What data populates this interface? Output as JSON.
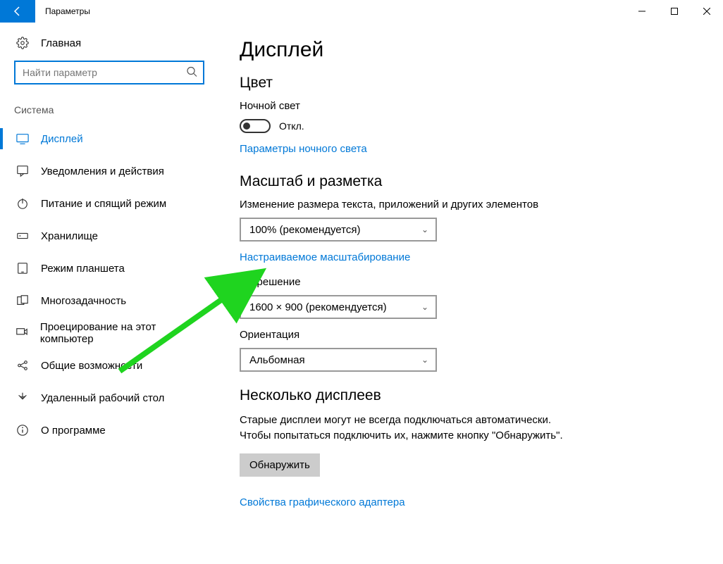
{
  "window": {
    "title": "Параметры"
  },
  "sidebar": {
    "home": "Главная",
    "search_placeholder": "Найти параметр",
    "section": "Система",
    "items": [
      {
        "label": "Дисплей",
        "icon": "display"
      },
      {
        "label": "Уведомления и действия",
        "icon": "notifications"
      },
      {
        "label": "Питание и спящий режим",
        "icon": "power"
      },
      {
        "label": "Хранилище",
        "icon": "storage"
      },
      {
        "label": "Режим планшета",
        "icon": "tablet"
      },
      {
        "label": "Многозадачность",
        "icon": "multitask"
      },
      {
        "label": "Проецирование на этот компьютер",
        "icon": "project"
      },
      {
        "label": "Общие возможности",
        "icon": "shared"
      },
      {
        "label": "Удаленный рабочий стол",
        "icon": "remote"
      },
      {
        "label": "О программе",
        "icon": "about"
      }
    ]
  },
  "main": {
    "heading": "Дисплей",
    "color_heading": "Цвет",
    "night_light_label": "Ночной свет",
    "night_light_state": "Откл.",
    "night_light_link": "Параметры ночного света",
    "scale_heading": "Масштаб и разметка",
    "scale_label": "Изменение размера текста, приложений и других элементов",
    "scale_value": "100% (рекомендуется)",
    "custom_scale_link": "Настраиваемое масштабирование",
    "resolution_label": "Разрешение",
    "resolution_value": "1600 × 900 (рекомендуется)",
    "orientation_label": "Ориентация",
    "orientation_value": "Альбомная",
    "multi_heading": "Несколько дисплеев",
    "multi_text": "Старые дисплеи могут не всегда подключаться автоматически. Чтобы попытаться подключить их, нажмите кнопку \"Обнаружить\".",
    "detect_btn": "Обнаружить",
    "adapter_link": "Свойства графического адаптера"
  }
}
